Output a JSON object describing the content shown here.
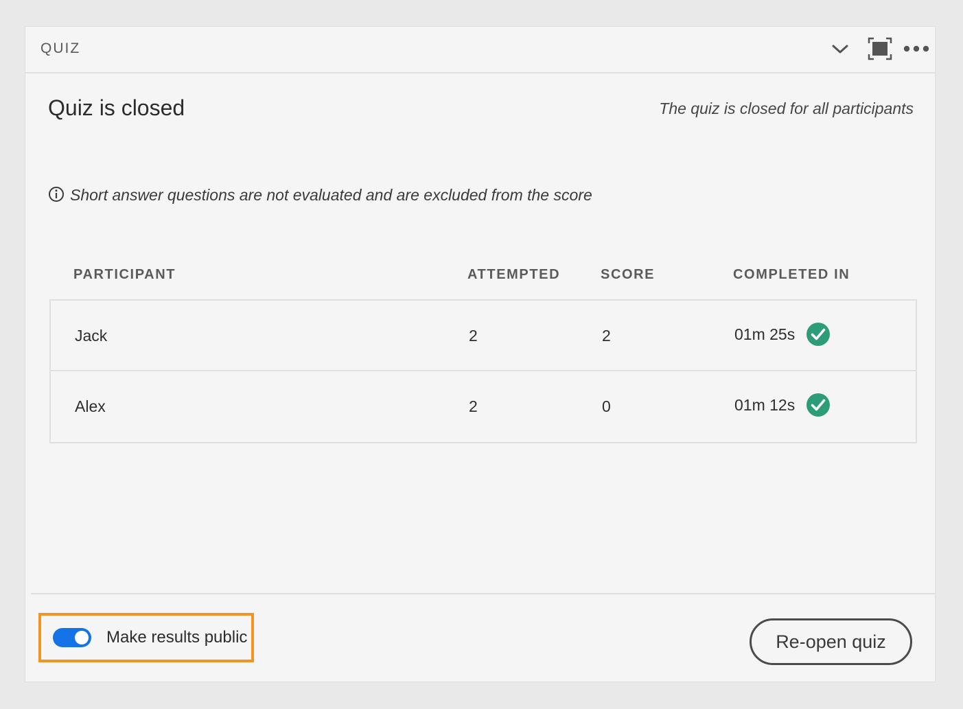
{
  "header": {
    "title": "QUIZ",
    "icons": [
      "chevron-down-icon",
      "fullscreen-icon",
      "more-icon"
    ]
  },
  "status": {
    "title": "Quiz is closed",
    "subtitle": "The quiz is closed for all participants"
  },
  "notice": {
    "icon": "info-icon",
    "text": "Short answer questions are not evaluated and are excluded from the score"
  },
  "table": {
    "columns": [
      "PARTICIPANT",
      "ATTEMPTED",
      "SCORE",
      "COMPLETED IN"
    ],
    "rows": [
      {
        "participant": "Jack",
        "attempted": "2",
        "score": "2",
        "completed_in": "01m 25s",
        "status_icon": "check-circle-icon"
      },
      {
        "participant": "Alex",
        "attempted": "2",
        "score": "0",
        "completed_in": "01m 12s",
        "status_icon": "check-circle-icon"
      }
    ]
  },
  "footer": {
    "toggle_label": "Make results public",
    "toggle_on": true,
    "reopen_label": "Re-open quiz"
  },
  "colors": {
    "accent": "#1473e6",
    "success": "#2d9d78",
    "highlight": "#f29423"
  }
}
